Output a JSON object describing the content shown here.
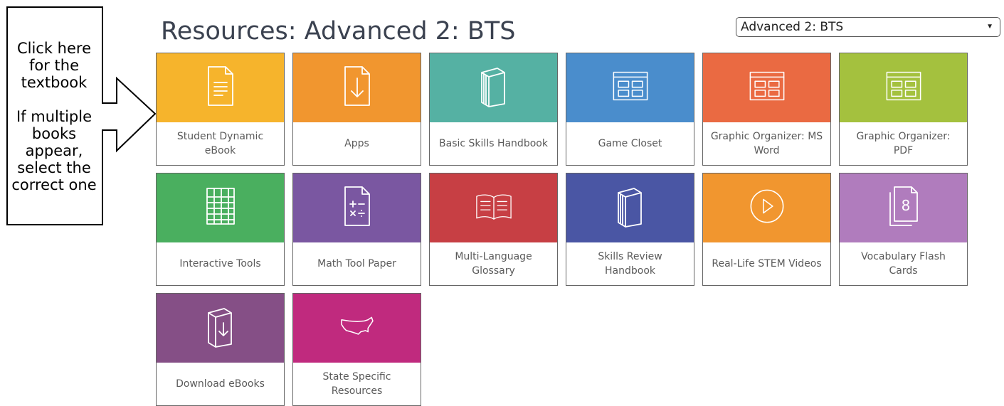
{
  "page_title": "Resources: Advanced 2: BTS",
  "book_select": {
    "value": "Advanced 2: BTS"
  },
  "callout": {
    "line1": "Click here\nfor the\ntextbook",
    "line2": "If multiple\nbooks\nappear,\nselect the\ncorrect one"
  },
  "tiles": [
    {
      "label": "Student Dynamic eBook",
      "color": "#f6b42c",
      "icon": "document-icon"
    },
    {
      "label": "Apps",
      "color": "#f1962f",
      "icon": "download-icon"
    },
    {
      "label": "Basic Skills Handbook",
      "color": "#55b1a3",
      "icon": "book-icon"
    },
    {
      "label": "Game Closet",
      "color": "#4a8dcc",
      "icon": "grid-window-icon"
    },
    {
      "label": "Graphic Organizer: MS Word",
      "color": "#ea6a42",
      "icon": "grid-window-icon"
    },
    {
      "label": "Graphic Organizer: PDF",
      "color": "#a4c13e",
      "icon": "grid-window-icon"
    },
    {
      "label": "Interactive Tools",
      "color": "#4aaf5f",
      "icon": "spreadsheet-icon"
    },
    {
      "label": "Math Tool Paper",
      "color": "#7a57a1",
      "icon": "math-paper-icon"
    },
    {
      "label": "Multi-Language Glossary",
      "color": "#c73f44",
      "icon": "open-book-icon"
    },
    {
      "label": "Skills Review Handbook",
      "color": "#4a56a4",
      "icon": "book-icon"
    },
    {
      "label": "Real-Life STEM Videos",
      "color": "#f1962f",
      "icon": "play-icon"
    },
    {
      "label": "Vocabulary Flash Cards",
      "color": "#b07cbd",
      "icon": "flash-cards-icon"
    },
    {
      "label": "Download eBooks",
      "color": "#854f86",
      "icon": "book-download-icon"
    },
    {
      "label": "State Specific Resources",
      "color": "#c02a7e",
      "icon": "usa-map-icon"
    }
  ]
}
